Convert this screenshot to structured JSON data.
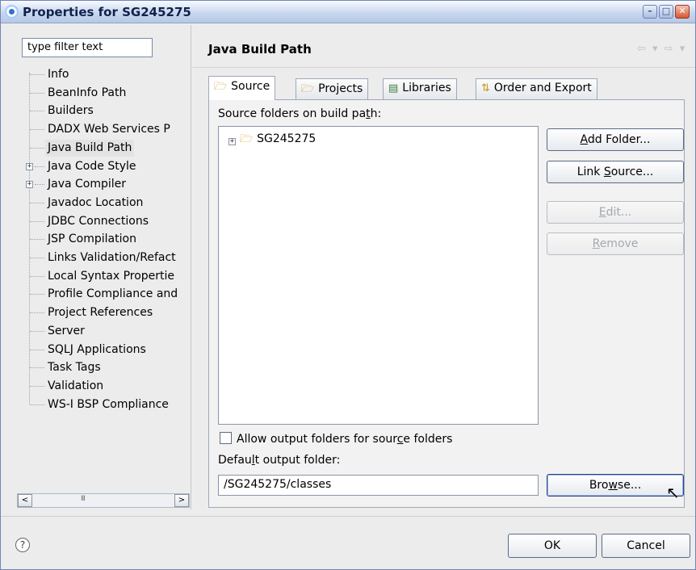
{
  "window": {
    "title": "Properties for SG245275",
    "controls": {
      "minimize": "–",
      "maximize": "□",
      "close": "✕"
    }
  },
  "filter": {
    "value": "type filter text"
  },
  "tree": {
    "items": [
      {
        "label": "Info",
        "expandable": false,
        "selected": false
      },
      {
        "label": "BeanInfo Path",
        "expandable": false,
        "selected": false
      },
      {
        "label": "Builders",
        "expandable": false,
        "selected": false
      },
      {
        "label": "DADX Web Services P",
        "expandable": false,
        "selected": false
      },
      {
        "label": "Java Build Path",
        "expandable": false,
        "selected": true
      },
      {
        "label": "Java Code Style",
        "expandable": true,
        "selected": false
      },
      {
        "label": "Java Compiler",
        "expandable": true,
        "selected": false
      },
      {
        "label": "Javadoc Location",
        "expandable": false,
        "selected": false
      },
      {
        "label": "JDBC Connections",
        "expandable": false,
        "selected": false
      },
      {
        "label": "JSP Compilation",
        "expandable": false,
        "selected": false
      },
      {
        "label": "Links Validation/Refact",
        "expandable": false,
        "selected": false
      },
      {
        "label": "Local Syntax Propertie",
        "expandable": false,
        "selected": false
      },
      {
        "label": "Profile Compliance and",
        "expandable": false,
        "selected": false
      },
      {
        "label": "Project References",
        "expandable": false,
        "selected": false
      },
      {
        "label": "Server",
        "expandable": false,
        "selected": false
      },
      {
        "label": "SQLJ Applications",
        "expandable": false,
        "selected": false
      },
      {
        "label": "Task Tags",
        "expandable": false,
        "selected": false
      },
      {
        "label": "Validation",
        "expandable": false,
        "selected": false
      },
      {
        "label": "WS-I BSP Compliance",
        "expandable": false,
        "selected": false
      }
    ],
    "scroll_left": "<",
    "scroll_right": ">",
    "grip": "III"
  },
  "page": {
    "title": "Java Build Path",
    "nav": "⇦ ▾ ⇨ ▾"
  },
  "tabs": [
    {
      "label": "Source",
      "icon": "source-folder-icon",
      "active": true
    },
    {
      "label": "Projects",
      "icon": "projects-icon",
      "active": false
    },
    {
      "label": "Libraries",
      "icon": "libraries-icon",
      "active": false
    },
    {
      "label": "Order and Export",
      "icon": "order-export-icon",
      "active": false
    }
  ],
  "source": {
    "label_pre": "Source folders on build pa",
    "label_mnemonic": "t",
    "label_post": "h:",
    "folders": [
      {
        "name": "SG245275",
        "expander": "+"
      }
    ]
  },
  "buttons": {
    "add_folder": {
      "pre": "",
      "mn": "A",
      "post": "dd Folder...",
      "disabled": false
    },
    "link_source": {
      "pre": "Link ",
      "mn": "S",
      "post": "ource...",
      "disabled": false
    },
    "edit": {
      "pre": "",
      "mn": "E",
      "post": "dit...",
      "disabled": true
    },
    "remove": {
      "pre": "",
      "mn": "R",
      "post": "emove",
      "disabled": true
    },
    "browse": {
      "pre": "Bro",
      "mn": "w",
      "post": "se...",
      "disabled": false
    }
  },
  "allow_output": {
    "pre": "Allow output folders for sour",
    "mn": "c",
    "post": "e folders",
    "checked": false
  },
  "default_output": {
    "label_pre": "Defau",
    "label_mn": "l",
    "label_post": "t output folder:",
    "value": "/SG245275/classes"
  },
  "footer": {
    "help": "?",
    "ok": "OK",
    "cancel": "Cancel"
  }
}
